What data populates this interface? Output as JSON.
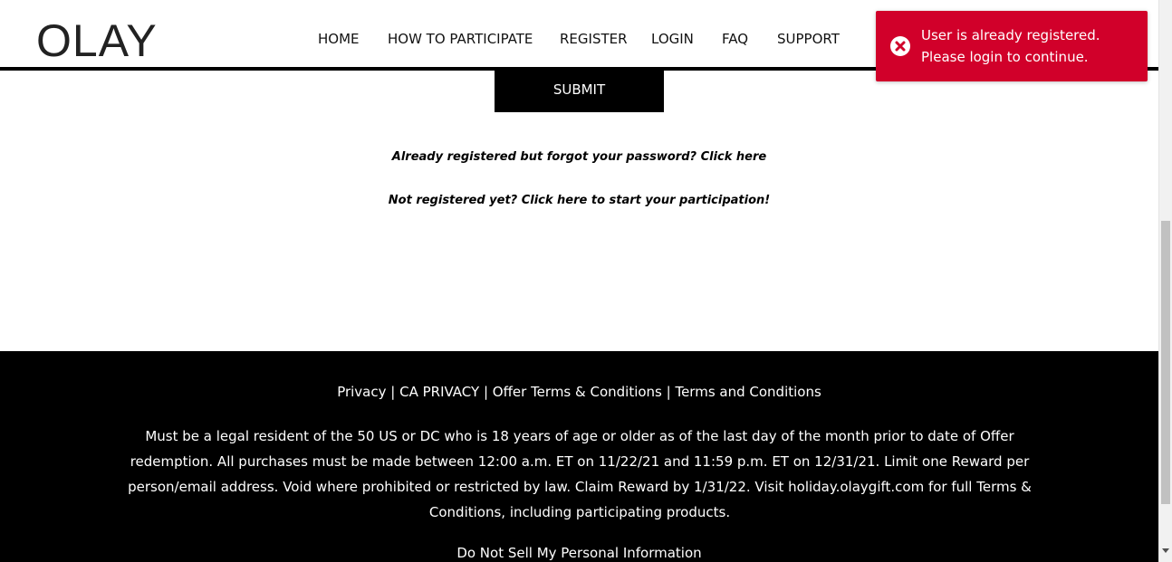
{
  "header": {
    "logo_text": "OLAY",
    "nav": [
      {
        "label": "HOME",
        "name": "nav-home"
      },
      {
        "label": "HOW TO PARTICIPATE",
        "name": "nav-how-to-participate"
      },
      {
        "label": "REGISTER",
        "name": "nav-register"
      },
      {
        "label": "LOGIN",
        "name": "nav-login"
      },
      {
        "label": "FAQ",
        "name": "nav-faq"
      },
      {
        "label": "SUPPORT",
        "name": "nav-support"
      }
    ]
  },
  "main": {
    "submit_label": "SUBMIT",
    "forgot_password_text": "Already registered but forgot your password? Click here",
    "not_registered_text": "Not registered yet? Click here to start your participation!"
  },
  "footer": {
    "links": [
      "Privacy",
      "CA PRIVACY",
      "Offer Terms & Conditions",
      "Terms and Conditions"
    ],
    "separator": " | ",
    "disclaimer": "Must be a legal resident of the 50 US or DC who is 18 years of age or older as of the last day of the month prior to date of Offer redemption. All purchases must be made between 12:00 a.m. ET on 11/22/21 and 11:59 p.m. ET on 12/31/21. Limit one Reward per person/email address. Void where prohibited or restricted by law. Claim Reward by 1/31/22. Visit holiday.olaygift.com for full Terms & Conditions, including participating products.",
    "do_not_sell": "Do Not Sell My Personal Information"
  },
  "toast": {
    "message_line1": "User is already registered.",
    "message_line2": "Please login to continue.",
    "icon": "error-circle-x-icon",
    "color": "#d1002a"
  },
  "colors": {
    "footer_bg": "#000000",
    "header_rule": "#000000",
    "button_bg": "#000000"
  }
}
